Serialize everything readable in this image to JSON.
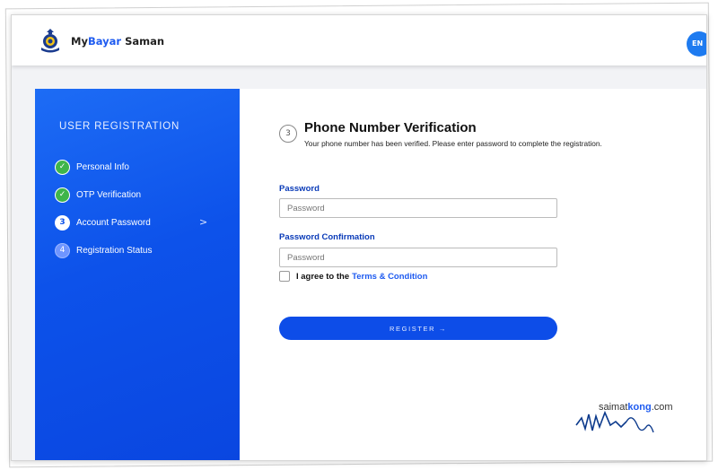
{
  "brand": {
    "part1": "My",
    "part2": "Bayar",
    "part3": " Saman"
  },
  "lang_badge": "EN",
  "sidebar": {
    "title": "USER REGISTRATION",
    "steps": [
      {
        "marker": "✓",
        "label": "Personal Info",
        "state": "done"
      },
      {
        "marker": "✓",
        "label": "OTP Verification",
        "state": "done"
      },
      {
        "marker": "3",
        "label": "Account Password",
        "state": "active"
      },
      {
        "marker": "4",
        "label": "Registration Status",
        "state": "pending"
      }
    ],
    "chevron": ">"
  },
  "main": {
    "step_number": "3",
    "title": "Phone Number Verification",
    "subtitle": "Your phone number has been verified. Please enter password to complete the registration.",
    "password_label": "Password",
    "password_placeholder": "Password",
    "confirm_label": "Password Confirmation",
    "confirm_placeholder": "Password",
    "agree_text": "I agree to the",
    "terms_link": "Terms & Condition",
    "register_label": "REGISTER →"
  },
  "watermark": {
    "part1": "saimat",
    "part2": "kong",
    "part3": ".com"
  },
  "colors": {
    "accent": "#0d4de8",
    "done": "#3fb54a",
    "label_blue": "#0a3bb8"
  }
}
